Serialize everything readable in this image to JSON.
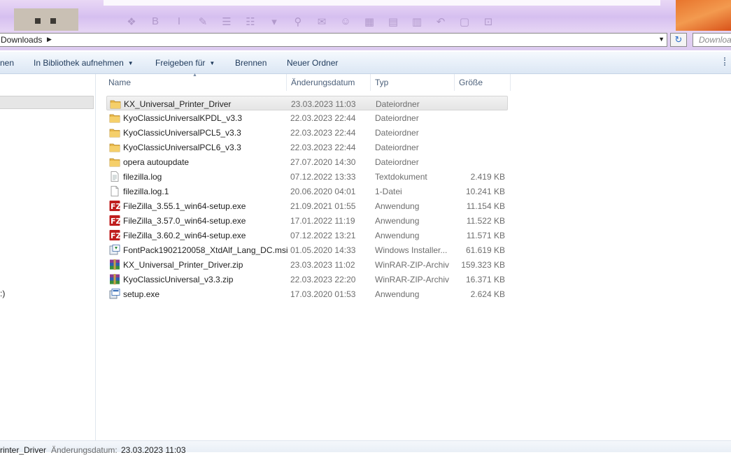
{
  "address": {
    "crumb": "Downloads",
    "search_placeholder": "Downloa"
  },
  "toolbar": {
    "items": [
      "nen",
      "In Bibliothek aufnehmen",
      "Freigeben für",
      "Brennen",
      "Neuer Ordner"
    ]
  },
  "sidebar": {
    "partial_text": ":)"
  },
  "columns": {
    "name": "Name",
    "date": "Änderungsdatum",
    "type": "Typ",
    "size": "Größe"
  },
  "files": [
    {
      "name": "KX_Universal_Printer_Driver",
      "date": "23.03.2023 11:03",
      "type": "Dateiordner",
      "size": "",
      "icon": "folder-icon",
      "selected": true
    },
    {
      "name": "KyoClassicUniversalKPDL_v3.3",
      "date": "22.03.2023 22:44",
      "type": "Dateiordner",
      "size": "",
      "icon": "folder-icon"
    },
    {
      "name": "KyoClassicUniversalPCL5_v3.3",
      "date": "22.03.2023 22:44",
      "type": "Dateiordner",
      "size": "",
      "icon": "folder-icon"
    },
    {
      "name": "KyoClassicUniversalPCL6_v3.3",
      "date": "22.03.2023 22:44",
      "type": "Dateiordner",
      "size": "",
      "icon": "folder-icon"
    },
    {
      "name": "opera autoupdate",
      "date": "27.07.2020 14:30",
      "type": "Dateiordner",
      "size": "",
      "icon": "folder-icon"
    },
    {
      "name": "filezilla.log",
      "date": "07.12.2022 13:33",
      "type": "Textdokument",
      "size": "2.419 KB",
      "icon": "text-file-icon"
    },
    {
      "name": "filezilla.log.1",
      "date": "20.06.2020 04:01",
      "type": "1-Datei",
      "size": "10.241 KB",
      "icon": "blank-file-icon"
    },
    {
      "name": "FileZilla_3.55.1_win64-setup.exe",
      "date": "21.09.2021 01:55",
      "type": "Anwendung",
      "size": "11.154 KB",
      "icon": "filezilla-icon"
    },
    {
      "name": "FileZilla_3.57.0_win64-setup.exe",
      "date": "17.01.2022 11:19",
      "type": "Anwendung",
      "size": "11.522 KB",
      "icon": "filezilla-icon"
    },
    {
      "name": "FileZilla_3.60.2_win64-setup.exe",
      "date": "07.12.2022 13:21",
      "type": "Anwendung",
      "size": "11.571 KB",
      "icon": "filezilla-icon"
    },
    {
      "name": "FontPack1902120058_XtdAlf_Lang_DC.msi",
      "date": "01.05.2020 14:33",
      "type": "Windows Installer...",
      "size": "61.619 KB",
      "icon": "installer-icon"
    },
    {
      "name": "KX_Universal_Printer_Driver.zip",
      "date": "23.03.2023 11:02",
      "type": "WinRAR-ZIP-Archiv",
      "size": "159.323 KB",
      "icon": "winrar-icon"
    },
    {
      "name": "KyoClassicUniversal_v3.3.zip",
      "date": "22.03.2023 22:20",
      "type": "WinRAR-ZIP-Archiv",
      "size": "16.371 KB",
      "icon": "winrar-icon"
    },
    {
      "name": "setup.exe",
      "date": "17.03.2020 01:53",
      "type": "Anwendung",
      "size": "2.624 KB",
      "icon": "setup-exe-icon"
    }
  ],
  "status": {
    "name": "rinter_Driver",
    "label": "Änderungsdatum:",
    "value": "23.03.2023 11:03"
  }
}
